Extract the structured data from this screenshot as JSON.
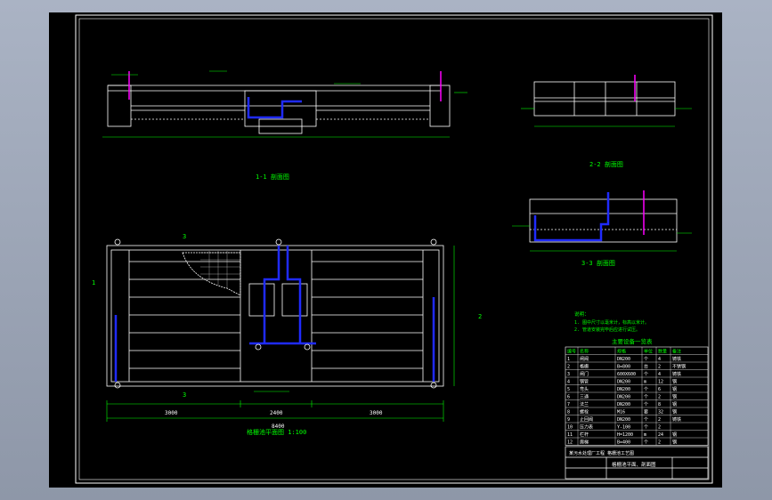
{
  "drawing": {
    "section_1_1_title": "1-1 剖面图",
    "section_2_2_title": "2-2 剖面图",
    "section_3_3_title": "3-3 剖面图",
    "plan_title": "格栅池平面图 1:100",
    "legend_title": "主要设备一览表",
    "notes_title": "说明：",
    "notes": [
      "1. 图中尺寸以毫米计，标高以米计。",
      "2. 管道安装完毕后应进行试压。"
    ],
    "section_mark_1": "1",
    "section_mark_2": "2",
    "section_mark_3": "3",
    "title_block_name": "格栅池平面、剖面图",
    "title_block_project": "某污水处理厂工程 格栅池工艺图",
    "dim_total": "8400",
    "dim_left": "3000",
    "dim_mid": "2400",
    "dim_right": "3000"
  },
  "table": {
    "headers": [
      "编号",
      "名称",
      "规格",
      "单位",
      "数量",
      "备注"
    ],
    "rows": [
      [
        "1",
        "闸阀",
        "DN200",
        "个",
        "4",
        "铸铁"
      ],
      [
        "2",
        "格栅",
        "B=800",
        "台",
        "2",
        "不锈钢"
      ],
      [
        "3",
        "闸门",
        "600X600",
        "个",
        "4",
        "铸铁"
      ],
      [
        "4",
        "钢管",
        "DN200",
        "m",
        "12",
        "钢"
      ],
      [
        "5",
        "弯头",
        "DN200",
        "个",
        "6",
        "钢"
      ],
      [
        "6",
        "三通",
        "DN200",
        "个",
        "2",
        "钢"
      ],
      [
        "7",
        "法兰",
        "DN200",
        "个",
        "8",
        "钢"
      ],
      [
        "8",
        "螺栓",
        "M16",
        "套",
        "32",
        "钢"
      ],
      [
        "9",
        "止回阀",
        "DN200",
        "个",
        "2",
        "铸铁"
      ],
      [
        "10",
        "压力表",
        "Y-100",
        "个",
        "2",
        ""
      ],
      [
        "11",
        "栏杆",
        "H=1200",
        "m",
        "24",
        "钢"
      ],
      [
        "12",
        "爬梯",
        "B=400",
        "个",
        "2",
        "钢"
      ]
    ]
  },
  "colors": {
    "background": "#000000",
    "line": "#ffffff",
    "dimension": "#00ff00",
    "pipe": "#1f2bff",
    "riser": "#ff00ff",
    "frame": "#ffffff"
  }
}
